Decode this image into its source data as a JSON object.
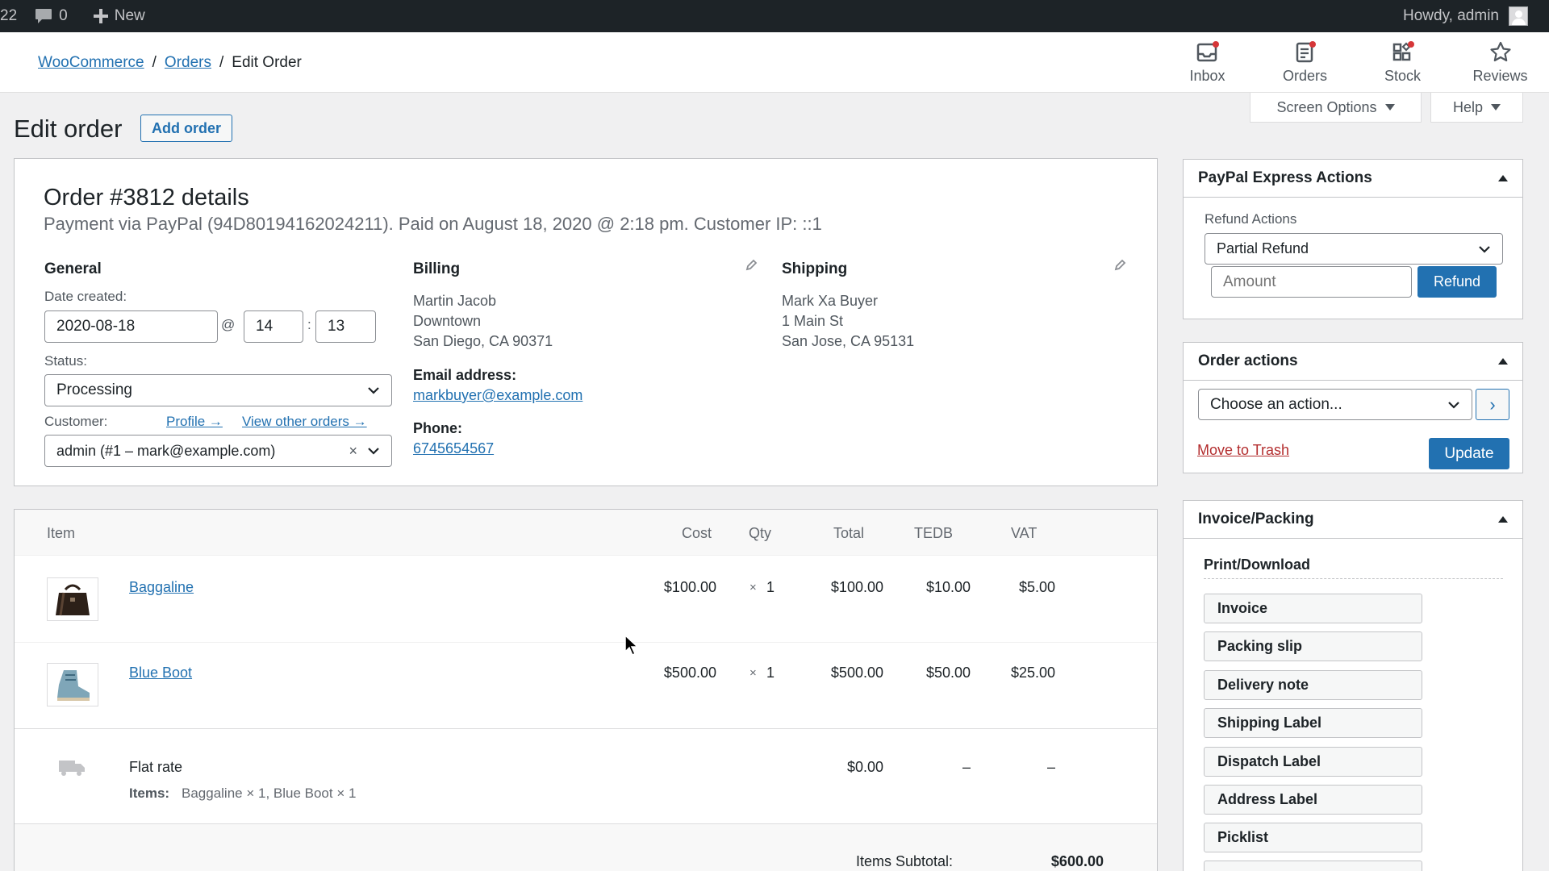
{
  "adminbar": {
    "site_fragment": "22",
    "comments_count": "0",
    "new_label": "New",
    "howdy": "Howdy, admin"
  },
  "breadcrumb": {
    "root": "WooCommerce",
    "orders": "Orders",
    "current": "Edit Order",
    "sep": "/"
  },
  "wc_tabs": [
    {
      "label": "Inbox",
      "icon": "inbox-icon"
    },
    {
      "label": "Orders",
      "icon": "orders-icon"
    },
    {
      "label": "Stock",
      "icon": "stock-icon"
    },
    {
      "label": "Reviews",
      "icon": "star-icon"
    }
  ],
  "page": {
    "title": "Edit order",
    "add_order": "Add order",
    "screen_options": "Screen Options",
    "help": "Help"
  },
  "order": {
    "heading": "Order #3812 details",
    "meta": "Payment via PayPal (94D80194162024211). Paid on August 18, 2020 @ 2:18 pm. Customer IP: ::1",
    "general": {
      "title": "General",
      "date_label": "Date created:",
      "date": "2020-08-18",
      "at": "@",
      "hour": "14",
      "colon": ":",
      "minute": "13",
      "status_label": "Status:",
      "status": "Processing",
      "customer_label": "Customer:",
      "profile_link": "Profile →",
      "other_orders_link": "View other orders →",
      "customer": "admin (#1 – mark@example.com)",
      "clear": "×"
    },
    "billing": {
      "title": "Billing",
      "name": "Martin Jacob",
      "line1": "Downtown",
      "line2": "San Diego, CA 90371",
      "email_label": "Email address:",
      "email": "markbuyer@example.com",
      "phone_label": "Phone:",
      "phone": "6745654567"
    },
    "shipping": {
      "title": "Shipping",
      "name": "Mark Xa Buyer",
      "line1": "1 Main St",
      "line2": "San Jose, CA 95131"
    }
  },
  "items": {
    "headers": {
      "item": "Item",
      "cost": "Cost",
      "qty": "Qty",
      "total": "Total",
      "tedb": "TEDB",
      "vat": "VAT"
    },
    "rows": [
      {
        "name": "Baggaline",
        "cost": "$100.00",
        "qty_x": "×",
        "qty": "1",
        "total": "$100.00",
        "tedb": "$10.00",
        "vat": "$5.00"
      },
      {
        "name": "Blue Boot",
        "cost": "$500.00",
        "qty_x": "×",
        "qty": "1",
        "total": "$500.00",
        "tedb": "$50.00",
        "vat": "$25.00"
      }
    ],
    "shipping_line": {
      "name": "Flat rate",
      "items_label": "Items:",
      "items": "Baggaline × 1, Blue Boot × 1",
      "total": "$0.00",
      "tedb": "–",
      "vat": "–"
    },
    "subtotal_label": "Items Subtotal:",
    "subtotal": "$600.00"
  },
  "paypal": {
    "title": "PayPal Express Actions",
    "refund_actions_label": "Refund Actions",
    "refund_type": "Partial Refund",
    "amount_placeholder": "Amount",
    "refund_button": "Refund"
  },
  "order_actions": {
    "title": "Order actions",
    "choose": "Choose an action...",
    "go": "›",
    "trash": "Move to Trash",
    "update": "Update"
  },
  "invoice": {
    "title": "Invoice/Packing",
    "print_label": "Print/Download",
    "buttons": [
      "Invoice",
      "Packing slip",
      "Delivery note",
      "Shipping Label",
      "Dispatch Label",
      "Address Label",
      "Picklist"
    ]
  },
  "colors": {
    "admin_bar": "#1d2327",
    "link": "#2271b1",
    "primary_button": "#2271b1",
    "trash": "#b32d2e",
    "badge": "#d63638"
  }
}
